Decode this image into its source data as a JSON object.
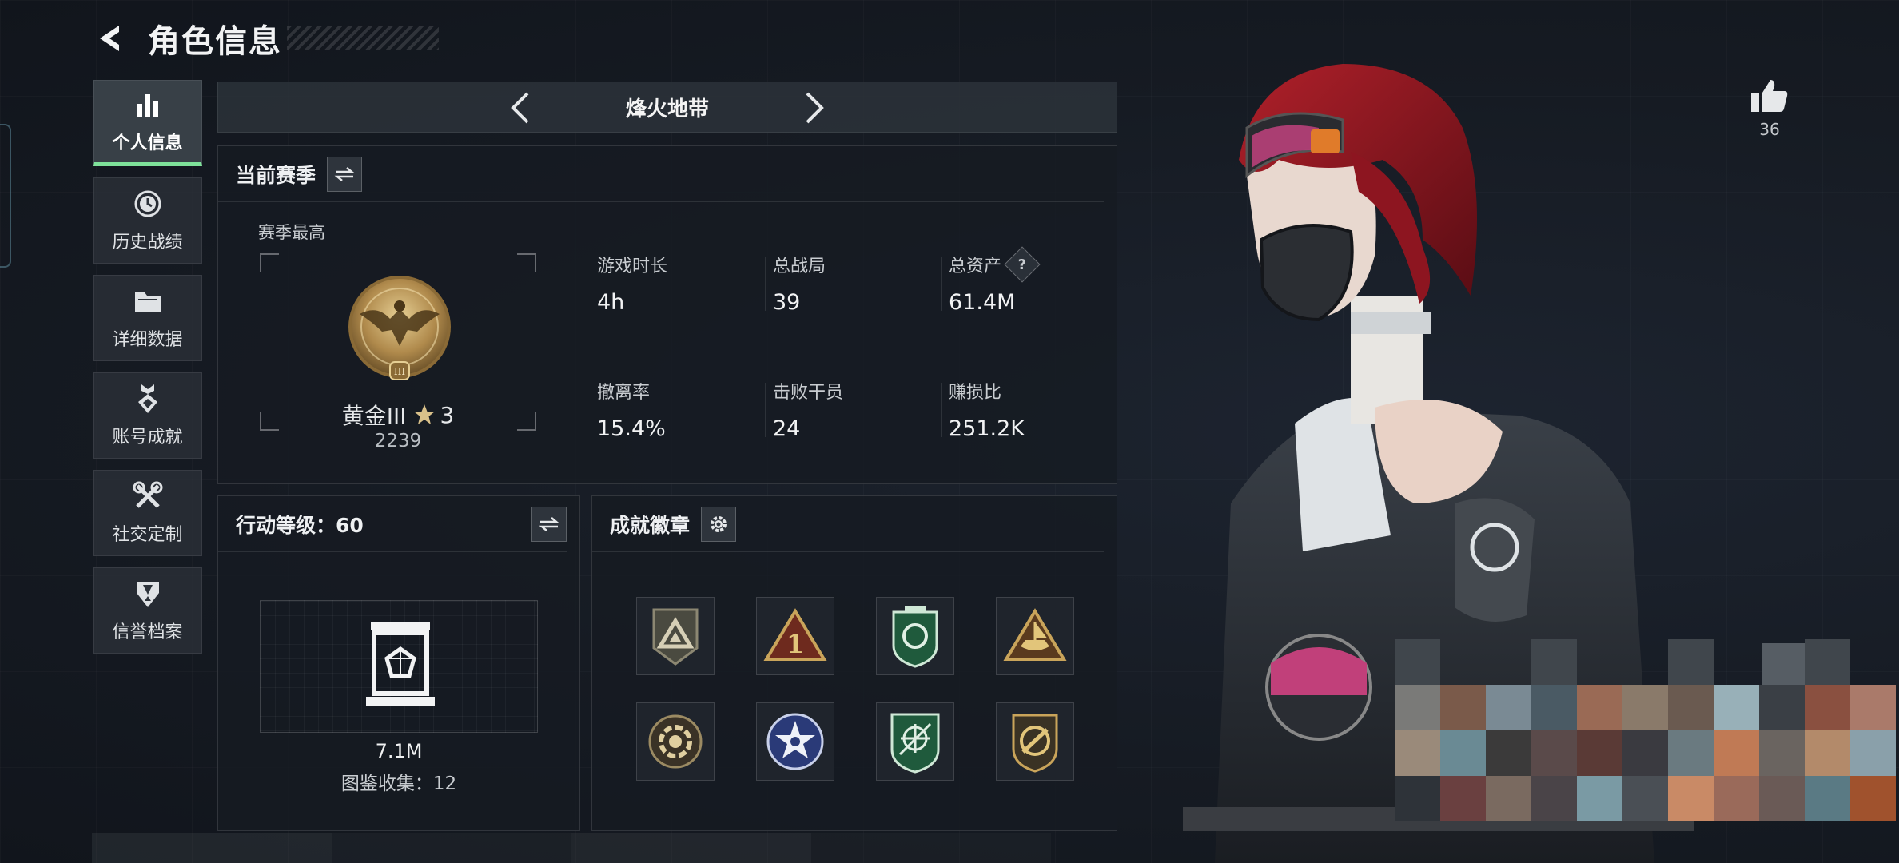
{
  "header": {
    "title": "角色信息"
  },
  "nav": {
    "items": [
      {
        "label": "个人信息",
        "icon": "bar-chart-icon",
        "active": true
      },
      {
        "label": "历史战绩",
        "icon": "clock-icon",
        "active": false
      },
      {
        "label": "详细数据",
        "icon": "folder-icon",
        "active": false
      },
      {
        "label": "账号成就",
        "icon": "medal-icon",
        "active": false
      },
      {
        "label": "社交定制",
        "icon": "tools-icon",
        "active": false
      },
      {
        "label": "信誉档案",
        "icon": "shield-badge-icon",
        "active": false
      }
    ]
  },
  "mode": {
    "title": "烽火地带"
  },
  "season": {
    "title": "当前赛季",
    "best_label": "赛季最高",
    "rank_name": "黄金III",
    "rank_stars": "3",
    "rank_score": "2239",
    "stats": [
      {
        "label": "游戏时长",
        "value": "4h"
      },
      {
        "label": "总战局",
        "value": "39"
      },
      {
        "label": "总资产",
        "value": "61.4M",
        "help": "?"
      },
      {
        "label": "撤离率",
        "value": "15.4%"
      },
      {
        "label": "击败干员",
        "value": "24"
      },
      {
        "label": "赚损比",
        "value": "251.2K"
      }
    ]
  },
  "level": {
    "title": "行动等级：60",
    "value": "7.1M",
    "codex": "图鉴收集：12"
  },
  "achievements": {
    "title": "成就徽章",
    "badges": [
      "triangle-badge-icon",
      "number-one-badge-icon",
      "green-shield-badge-icon",
      "ship-triangle-badge-icon",
      "flower-badge-icon",
      "star-circle-badge-icon",
      "green-crosshair-badge-icon",
      "weapon-shield-badge-icon"
    ]
  },
  "likes": {
    "count": "36"
  },
  "colors": {
    "accent": "#7ee29a",
    "gold": "#c9a45a",
    "panel": "#161b22"
  }
}
